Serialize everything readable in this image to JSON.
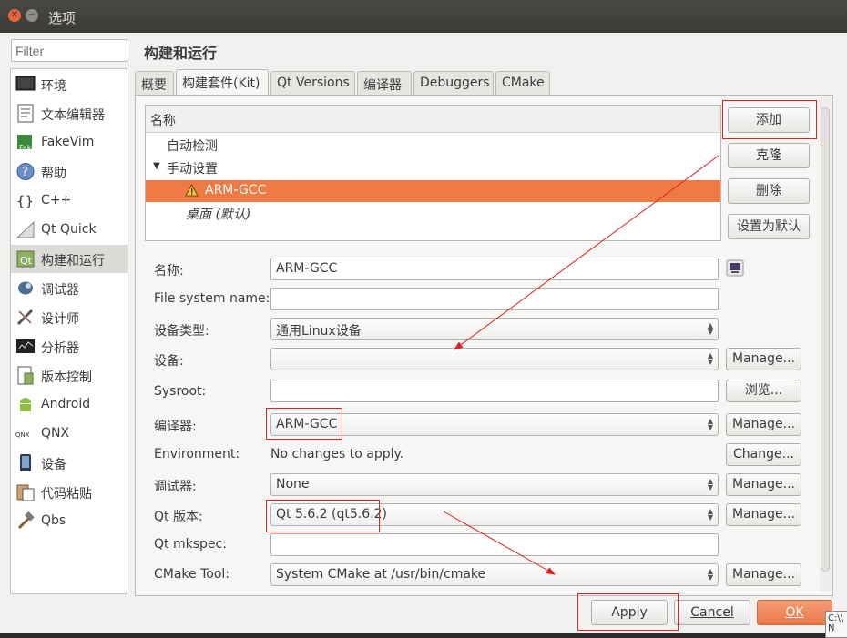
{
  "window": {
    "title": "选项"
  },
  "filter": {
    "placeholder": "Filter"
  },
  "sidebar": {
    "items": [
      {
        "label": "环境",
        "icon": "monitor-icon"
      },
      {
        "label": "文本编辑器",
        "icon": "text-editor-icon"
      },
      {
        "label": "FakeVim",
        "icon": "fakevim-icon"
      },
      {
        "label": "帮助",
        "icon": "help-icon"
      },
      {
        "label": "C++",
        "icon": "cpp-icon"
      },
      {
        "label": "Qt Quick",
        "icon": "qt-quick-icon"
      },
      {
        "label": "构建和运行",
        "icon": "build-run-icon"
      },
      {
        "label": "调试器",
        "icon": "debugger-icon"
      },
      {
        "label": "设计师",
        "icon": "designer-icon"
      },
      {
        "label": "分析器",
        "icon": "analyzer-icon"
      },
      {
        "label": "版本控制",
        "icon": "version-control-icon"
      },
      {
        "label": "Android",
        "icon": "android-icon"
      },
      {
        "label": "QNX",
        "icon": "qnx-icon"
      },
      {
        "label": "设备",
        "icon": "device-icon"
      },
      {
        "label": "代码粘贴",
        "icon": "code-paste-icon"
      },
      {
        "label": "Qbs",
        "icon": "qbs-icon"
      }
    ],
    "selected": "构建和运行"
  },
  "page": {
    "title": "构建和运行"
  },
  "tabs": [
    {
      "label": "概要"
    },
    {
      "label": "构建套件(Kit)"
    },
    {
      "label": "Qt Versions"
    },
    {
      "label": "编译器"
    },
    {
      "label": "Debuggers"
    },
    {
      "label": "CMake"
    }
  ],
  "kits": {
    "header": "名称",
    "rows": [
      {
        "label": "自动检测"
      },
      {
        "label": "手动设置"
      },
      {
        "label": "ARM-GCC",
        "warning": true
      },
      {
        "label": "桌面 (默认)"
      }
    ],
    "buttons": {
      "add": "添加",
      "clone": "克隆",
      "remove": "删除",
      "make_default": "设置为默认"
    }
  },
  "form": {
    "name_label": "名称:",
    "name_value": "ARM-GCC",
    "fs_label": "File system name:",
    "fs_value": "",
    "device_type_label": "设备类型:",
    "device_type_value": "通用Linux设备",
    "device_label": "设备:",
    "device_value": "",
    "sysroot_label": "Sysroot:",
    "sysroot_value": "",
    "browse": "浏览...",
    "compiler_label": "编译器:",
    "compiler_value": "ARM-GCC",
    "env_label": "Environment:",
    "env_value": "No changes to apply.",
    "change": "Change...",
    "debugger_label": "调试器:",
    "debugger_value": "None",
    "qt_label": "Qt 版本:",
    "qt_value": "Qt 5.6.2 (qt5.6.2)",
    "mkspec_label": "Qt mkspec:",
    "mkspec_value": "",
    "cmake_label": "CMake Tool:",
    "cmake_value": "System CMake at /usr/bin/cmake",
    "manage": "Manage..."
  },
  "footer": {
    "apply": "Apply",
    "cancel": "Cancel",
    "ok": "OK"
  },
  "tooltip": {
    "text": "C:\\\\ N"
  },
  "colors": {
    "selection": "#ef7a43",
    "annotation": "#e02020",
    "ok_button": "#ec7a4c"
  }
}
